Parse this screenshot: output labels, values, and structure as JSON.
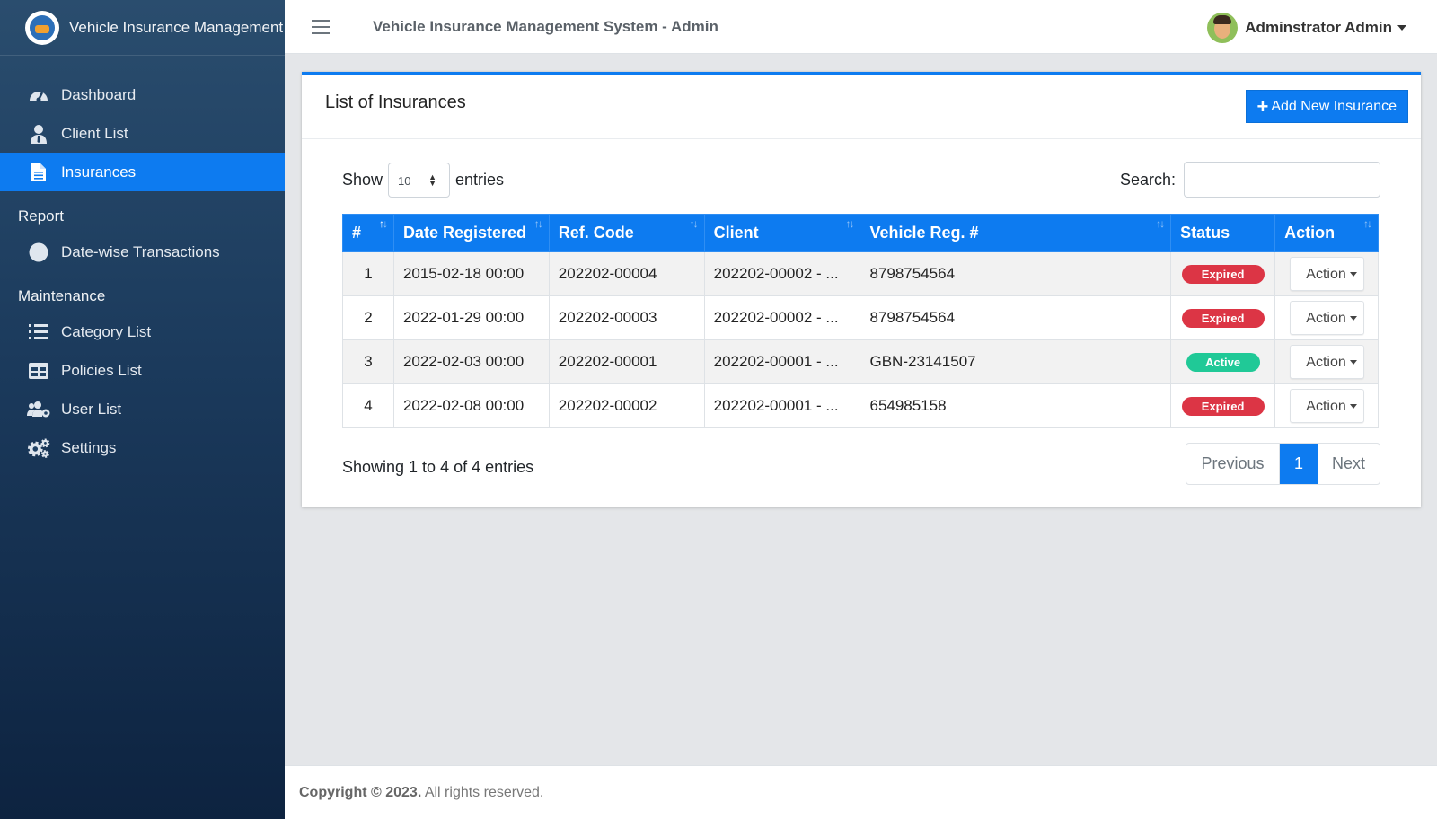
{
  "brand": {
    "title": "Vehicle Insurance Management"
  },
  "sidebar": {
    "items": [
      {
        "label": "Dashboard",
        "icon": "tachometer-icon"
      },
      {
        "label": "Client List",
        "icon": "user-tie-icon"
      },
      {
        "label": "Insurances",
        "icon": "file-icon",
        "active": true
      }
    ],
    "report_header": "Report",
    "report_items": [
      {
        "label": "Date-wise Transactions",
        "icon": "circle-icon"
      }
    ],
    "maintenance_header": "Maintenance",
    "maintenance_items": [
      {
        "label": "Category List",
        "icon": "list-icon"
      },
      {
        "label": "Policies List",
        "icon": "table-icon"
      },
      {
        "label": "User List",
        "icon": "users-cog-icon"
      },
      {
        "label": "Settings",
        "icon": "cogs-icon"
      }
    ]
  },
  "topbar": {
    "title": "Vehicle Insurance Management System - Admin",
    "user": "Adminstrator Admin"
  },
  "card": {
    "title": "List of Insurances",
    "add_button": "Add New Insurance",
    "show_label": "Show",
    "entries_value": "10",
    "entries_label": "entries",
    "search_label": "Search:",
    "search_value": "",
    "columns": [
      "#",
      "Date Registered",
      "Ref. Code",
      "Client",
      "Vehicle Reg. #",
      "Status",
      "Action"
    ],
    "rows": [
      {
        "num": "1",
        "date": "2015-02-18 00:00",
        "ref": "202202-00004",
        "client": "202202-00002 - ...",
        "vehicle": "8798754564",
        "status": "Expired",
        "action": "Action"
      },
      {
        "num": "2",
        "date": "2022-01-29 00:00",
        "ref": "202202-00003",
        "client": "202202-00002 - ...",
        "vehicle": "8798754564",
        "status": "Expired",
        "action": "Action"
      },
      {
        "num": "3",
        "date": "2022-02-03 00:00",
        "ref": "202202-00001",
        "client": "202202-00001 - ...",
        "vehicle": "GBN-23141507",
        "status": "Active",
        "action": "Action"
      },
      {
        "num": "4",
        "date": "2022-02-08 00:00",
        "ref": "202202-00002",
        "client": "202202-00001 - ...",
        "vehicle": "654985158",
        "status": "Expired",
        "action": "Action"
      }
    ],
    "info": "Showing 1 to 4 of 4 entries",
    "pager": {
      "prev": "Previous",
      "current": "1",
      "next": "Next"
    }
  },
  "footer": {
    "copyright": "Copyright © 2023.",
    "rights": "All rights reserved."
  },
  "colors": {
    "primary": "#0d7bf0",
    "expired": "#dc3545",
    "active": "#20c997",
    "sidebar": "#1b3a5c"
  }
}
